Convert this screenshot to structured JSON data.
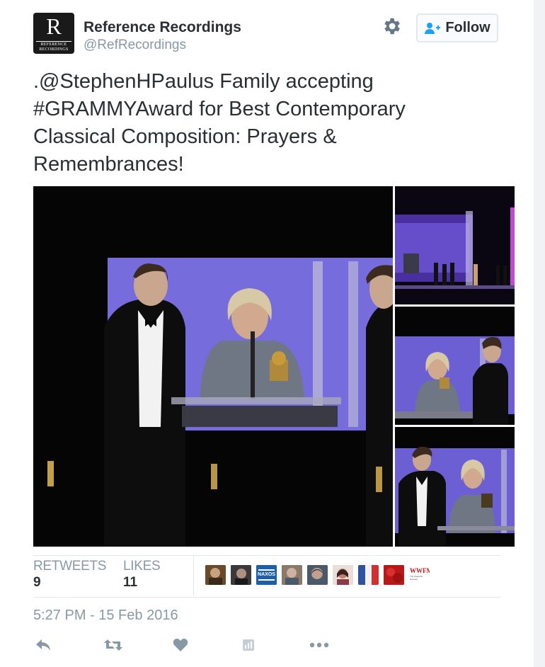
{
  "account": {
    "name": "Reference Recordings",
    "handle": "@RefRecordings",
    "avatar_monogram": "R",
    "avatar_text_line1": "REFERENCE",
    "avatar_text_line2": "RECORDINGS"
  },
  "follow_button": {
    "label": "Follow",
    "icon": "add-user-icon"
  },
  "settings_icon": "gear-icon",
  "tweet": {
    "text": ".@StephenHPaulus Family accepting #GRAMMYAward for Best Contemporary Classical Composition: Prayers & Remembrances!"
  },
  "stats": {
    "retweets_label": "RETWEETS",
    "retweets_value": "9",
    "likes_label": "LIKES",
    "likes_value": "11"
  },
  "likers": [
    {
      "alt": "liker avatar 1",
      "color": "#8a6a4a"
    },
    {
      "alt": "liker avatar 2",
      "color": "#4a4a4a"
    },
    {
      "alt": "NAXOS",
      "color": "#1e5fa8"
    },
    {
      "alt": "liker avatar 4",
      "color": "#9a8a7a"
    },
    {
      "alt": "liker avatar 5",
      "color": "#5a6a7a"
    },
    {
      "alt": "liker avatar 6",
      "color": "#a08a80"
    },
    {
      "alt": "liker avatar 7",
      "color": "#d0d8e8"
    },
    {
      "alt": "liker avatar 8",
      "color": "#c81e1e"
    },
    {
      "alt": "WWFM",
      "color": "#ffffff"
    }
  ],
  "liker_logo_text": {
    "naxos": "NAXOS",
    "wwfm": "WWFM",
    "wwfm_sub": "The Classical Network"
  },
  "timestamp": "5:27 PM - 15 Feb 2016",
  "actions": [
    "reply-icon",
    "retweet-icon",
    "like-icon",
    "tweet-activity-icon",
    "more-icon"
  ],
  "colors": {
    "text": "#292f33",
    "secondary": "#8899a6",
    "accent_blue": "#1da1f2",
    "divider": "#e1e8ed",
    "stage_purple": "#6e5fd6"
  }
}
